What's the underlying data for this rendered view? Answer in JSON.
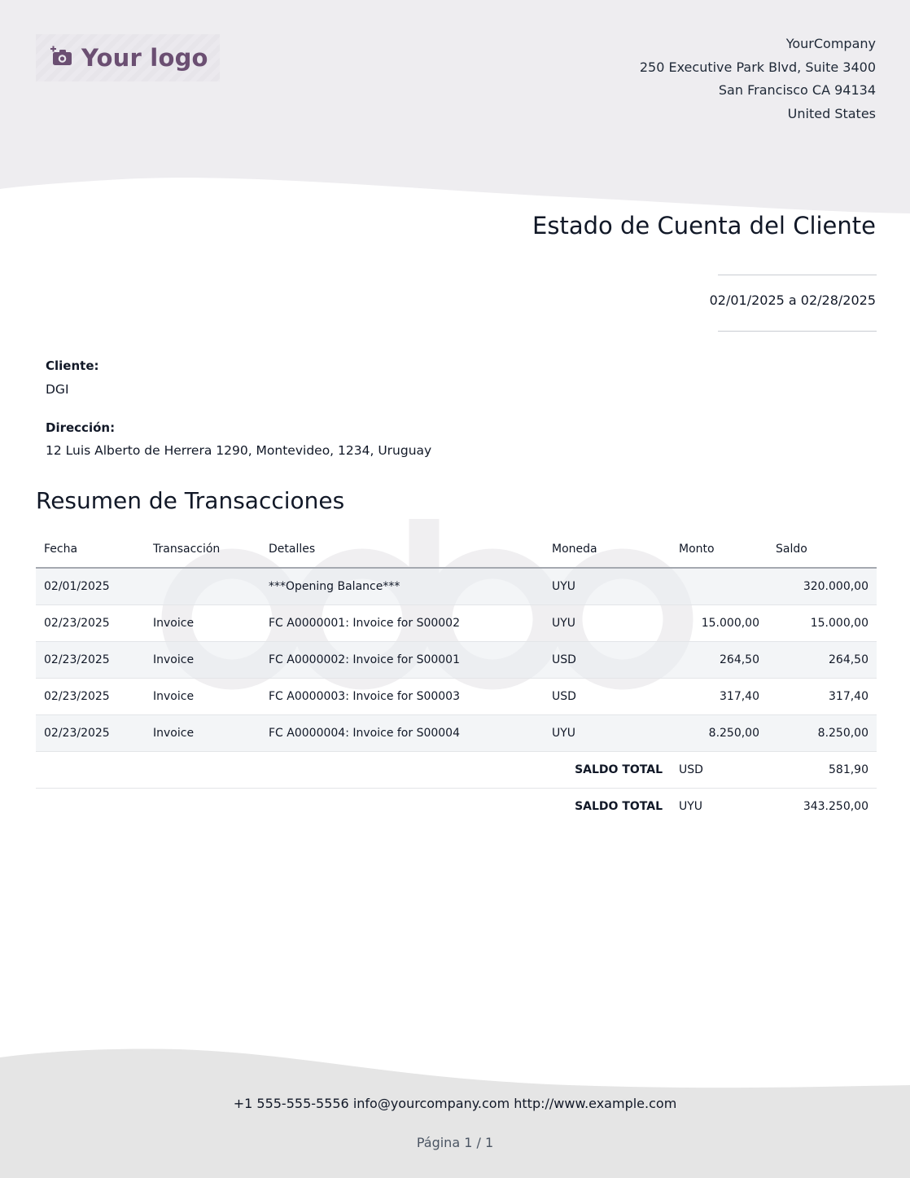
{
  "logo": {
    "text": "Your logo",
    "icon": "camera-plus-icon",
    "color": "#6b4f72"
  },
  "company": {
    "name": "YourCompany",
    "address_line1": "250 Executive Park Blvd, Suite 3400",
    "address_line2": "San Francisco CA 94134",
    "country": "United States"
  },
  "document": {
    "title": "Estado de Cuenta del Cliente",
    "period": "02/01/2025 a 02/28/2025"
  },
  "customer": {
    "label": "Cliente:",
    "name": "DGI",
    "address_label": "Dirección:",
    "address": "12 Luis Alberto de Herrera 1290, Montevideo, 1234, Uruguay"
  },
  "summary": {
    "title": "Resumen de Transacciones",
    "columns": [
      "Fecha",
      "Transacción",
      "Detalles",
      "Moneda",
      "Monto",
      "Saldo"
    ],
    "rows": [
      {
        "fecha": "02/01/2025",
        "transaccion": "",
        "detalles": "***Opening Balance***",
        "moneda": "UYU",
        "monto": "",
        "saldo": "320.000,00"
      },
      {
        "fecha": "02/23/2025",
        "transaccion": "Invoice",
        "detalles": "FC A0000001: Invoice for S00002",
        "moneda": "UYU",
        "monto": "15.000,00",
        "saldo": "15.000,00"
      },
      {
        "fecha": "02/23/2025",
        "transaccion": "Invoice",
        "detalles": "FC A0000002: Invoice for S00001",
        "moneda": "USD",
        "monto": "264,50",
        "saldo": "264,50"
      },
      {
        "fecha": "02/23/2025",
        "transaccion": "Invoice",
        "detalles": "FC A0000003: Invoice for S00003",
        "moneda": "USD",
        "monto": "317,40",
        "saldo": "317,40"
      },
      {
        "fecha": "02/23/2025",
        "transaccion": "Invoice",
        "detalles": "FC A0000004: Invoice for S00004",
        "moneda": "UYU",
        "monto": "8.250,00",
        "saldo": "8.250,00"
      }
    ],
    "totals": [
      {
        "label": "SALDO TOTAL",
        "moneda": "USD",
        "saldo": "581,90"
      },
      {
        "label": "SALDO TOTAL",
        "moneda": "UYU",
        "saldo": "343.250,00"
      }
    ]
  },
  "footer": {
    "contact": "+1 555-555-5556 info@yourcompany.com http://www.example.com",
    "page": "Página 1 / 1"
  },
  "colors": {
    "header_bg": "#eeedf0",
    "footer_bg": "#e5e5e5",
    "watermark": "#f0f0f2",
    "accent": "#6b4f72"
  }
}
